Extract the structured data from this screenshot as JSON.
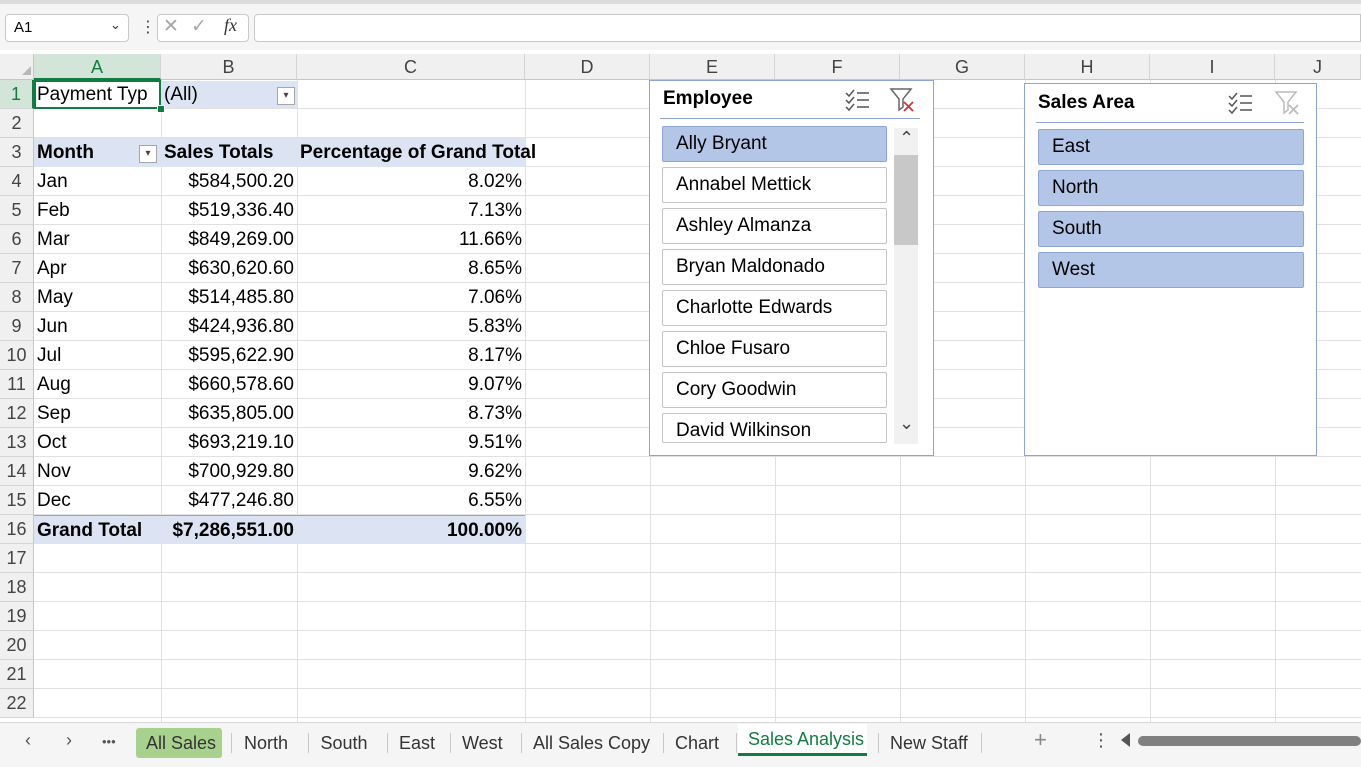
{
  "formula_bar": {
    "name_box": "A1",
    "cancel_glyph": "✕",
    "enter_glyph": "✓",
    "fx_label": "fx",
    "formula": ""
  },
  "columns": [
    "A",
    "B",
    "C",
    "D",
    "E",
    "F",
    "G",
    "H",
    "I",
    "J"
  ],
  "rows": [
    "1",
    "2",
    "3",
    "4",
    "5",
    "6",
    "7",
    "8",
    "9",
    "10",
    "11",
    "12",
    "13",
    "14",
    "15",
    "16",
    "17",
    "18",
    "19",
    "20",
    "21",
    "22"
  ],
  "pivot": {
    "filter_label": "Payment Type",
    "filter_label_visible": "Payment Typ",
    "filter_value": "(All)",
    "headers": {
      "month": "Month",
      "sales": "Sales Totals",
      "pct": "Percentage of Grand Total"
    },
    "rows": [
      {
        "month": "Jan",
        "sales": "$584,500.20",
        "pct": "8.02%"
      },
      {
        "month": "Feb",
        "sales": "$519,336.40",
        "pct": "7.13%"
      },
      {
        "month": "Mar",
        "sales": "$849,269.00",
        "pct": "11.66%"
      },
      {
        "month": "Apr",
        "sales": "$630,620.60",
        "pct": "8.65%"
      },
      {
        "month": "May",
        "sales": "$514,485.80",
        "pct": "7.06%"
      },
      {
        "month": "Jun",
        "sales": "$424,936.80",
        "pct": "5.83%"
      },
      {
        "month": "Jul",
        "sales": "$595,622.90",
        "pct": "8.17%"
      },
      {
        "month": "Aug",
        "sales": "$660,578.60",
        "pct": "9.07%"
      },
      {
        "month": "Sep",
        "sales": "$635,805.00",
        "pct": "8.73%"
      },
      {
        "month": "Oct",
        "sales": "$693,219.10",
        "pct": "9.51%"
      },
      {
        "month": "Nov",
        "sales": "$700,929.80",
        "pct": "9.62%"
      },
      {
        "month": "Dec",
        "sales": "$477,246.80",
        "pct": "6.55%"
      }
    ],
    "grand_total": {
      "label": "Grand Total",
      "sales": "$7,286,551.00",
      "pct": "100.00%"
    }
  },
  "slicer_employee": {
    "title": "Employee",
    "items": [
      {
        "label": "Ally Bryant",
        "selected": true
      },
      {
        "label": "Annabel Mettick",
        "selected": false
      },
      {
        "label": "Ashley Almanza",
        "selected": false
      },
      {
        "label": "Bryan Maldonado",
        "selected": false
      },
      {
        "label": "Charlotte Edwards",
        "selected": false
      },
      {
        "label": "Chloe Fusaro",
        "selected": false
      },
      {
        "label": "Cory Goodwin",
        "selected": false
      },
      {
        "label": "David Wilkinson",
        "selected": false
      }
    ],
    "scroll_up": "⌃",
    "scroll_down": "⌄"
  },
  "slicer_area": {
    "title": "Sales Area",
    "items": [
      {
        "label": "East",
        "selected": true
      },
      {
        "label": "North",
        "selected": true
      },
      {
        "label": "South",
        "selected": true
      },
      {
        "label": "West",
        "selected": true
      }
    ]
  },
  "tabs": {
    "more": "•••",
    "prev": "‹",
    "next": "›",
    "add": "+",
    "options": "⋮",
    "sheets": [
      "All Sales",
      "North",
      "South",
      "East",
      "West",
      "All Sales Copy",
      "Chart",
      "Sales Analysis",
      "New Staff"
    ],
    "active": "Sales Analysis"
  },
  "colors": {
    "accent_green": "#107c41",
    "pivot_highlight": "#dce3f2",
    "slicer_selected": "#b4c6e7",
    "tab_green": "#a9d18e"
  },
  "icons": [
    "chevron-down-icon",
    "cancel-icon",
    "enter-icon",
    "fx-icon",
    "multi-select-icon",
    "clear-filter-icon",
    "scroll-up-icon",
    "scroll-down-icon",
    "add-sheet-icon"
  ]
}
